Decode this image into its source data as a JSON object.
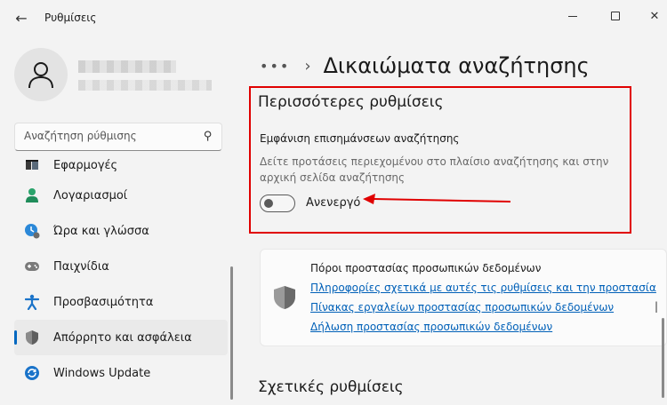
{
  "window": {
    "title": "Ρυθμίσεις"
  },
  "sidebar": {
    "search_placeholder": "Αναζήτηση ρύθμισης",
    "items": [
      {
        "label": "Εφαρμογές",
        "icon": "apps-icon"
      },
      {
        "label": "Λογαριασμοί",
        "icon": "accounts-icon"
      },
      {
        "label": "Ώρα και γλώσσα",
        "icon": "time-language-icon"
      },
      {
        "label": "Παιχνίδια",
        "icon": "gamepad-icon"
      },
      {
        "label": "Προσβασιμότητα",
        "icon": "accessibility-icon"
      },
      {
        "label": "Απόρρητο και ασφάλεια",
        "icon": "shield-icon",
        "active": true
      },
      {
        "label": "Windows Update",
        "icon": "update-icon"
      }
    ]
  },
  "main": {
    "breadcrumb_dots": "•••",
    "page_title": "Δικαιώματα αναζήτησης",
    "more_settings": {
      "title": "Περισσότερες ρυθμίσεις",
      "setting_label": "Εμφάνιση επισημάνσεων αναζήτησης",
      "setting_desc": "Δείτε προτάσεις περιεχομένου στο πλαίσιο αναζήτησης και στην αρχική σελίδα αναζήτησης",
      "toggle_state": "Ανενεργό"
    },
    "privacy_card": {
      "heading": "Πόροι προστασίας προσωπικών δεδομένων",
      "links": [
        "Πληροφορίες σχετικά με αυτές τις ρυθμίσεις και την προστασία",
        "Πίνακας εργαλείων προστασίας προσωπικών δεδομένων",
        "Δήλωση προστασίας προσωπικών δεδομένων"
      ],
      "separator": "|"
    },
    "related_title": "Σχετικές ρυθμίσεις"
  },
  "colors": {
    "accent": "#0067c0",
    "link": "#0060b8",
    "annotation": "#e00000"
  }
}
